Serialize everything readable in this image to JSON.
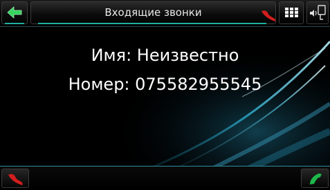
{
  "header": {
    "title": "Входящие звонки"
  },
  "caller": {
    "name_line": "Имя: Неизвестно",
    "number_line": "Номер: 075582955545"
  },
  "icons": {
    "back": "back-arrow-icon",
    "hangup_top": "hangup-icon",
    "keypad": "keypad-icon",
    "audio": "audio-settings-icon",
    "reject": "reject-call-icon",
    "accept": "accept-call-icon"
  },
  "colors": {
    "accent": "#1fb0a0",
    "hangup": "#d21e1e",
    "accept": "#1fb84a"
  }
}
